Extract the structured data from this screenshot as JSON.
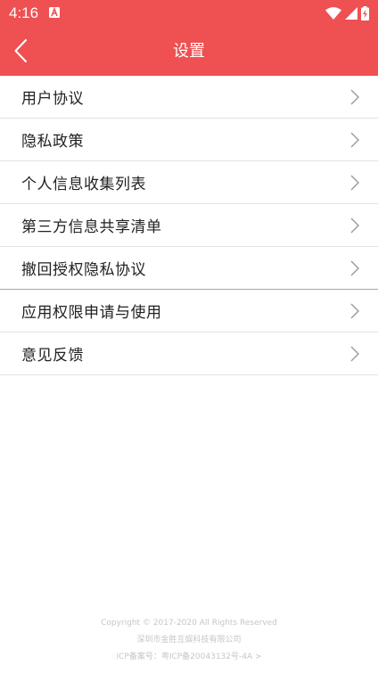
{
  "status_bar": {
    "time": "4:16",
    "icons": [
      "app-notification-icon",
      "wifi-icon",
      "signal-icon",
      "battery-charging-icon"
    ]
  },
  "header": {
    "title": "设置",
    "back_icon": "chevron-left-icon",
    "background_color": "#ef5052"
  },
  "menu": {
    "items": [
      {
        "label": "用户协议"
      },
      {
        "label": "隐私政策"
      },
      {
        "label": "个人信息收集列表"
      },
      {
        "label": "第三方信息共享清单"
      },
      {
        "label": "撤回授权隐私协议"
      },
      {
        "label": "应用权限申请与使用"
      },
      {
        "label": "意见反馈"
      }
    ],
    "chevron_icon": "chevron-right-icon"
  },
  "footer": {
    "copyright": "Copyright © 2017-2020 All Rights Reserved",
    "company": "深圳市金胜互娱科技有限公司",
    "icp": "ICP备案号：粤ICP备20043132号-4A >"
  }
}
